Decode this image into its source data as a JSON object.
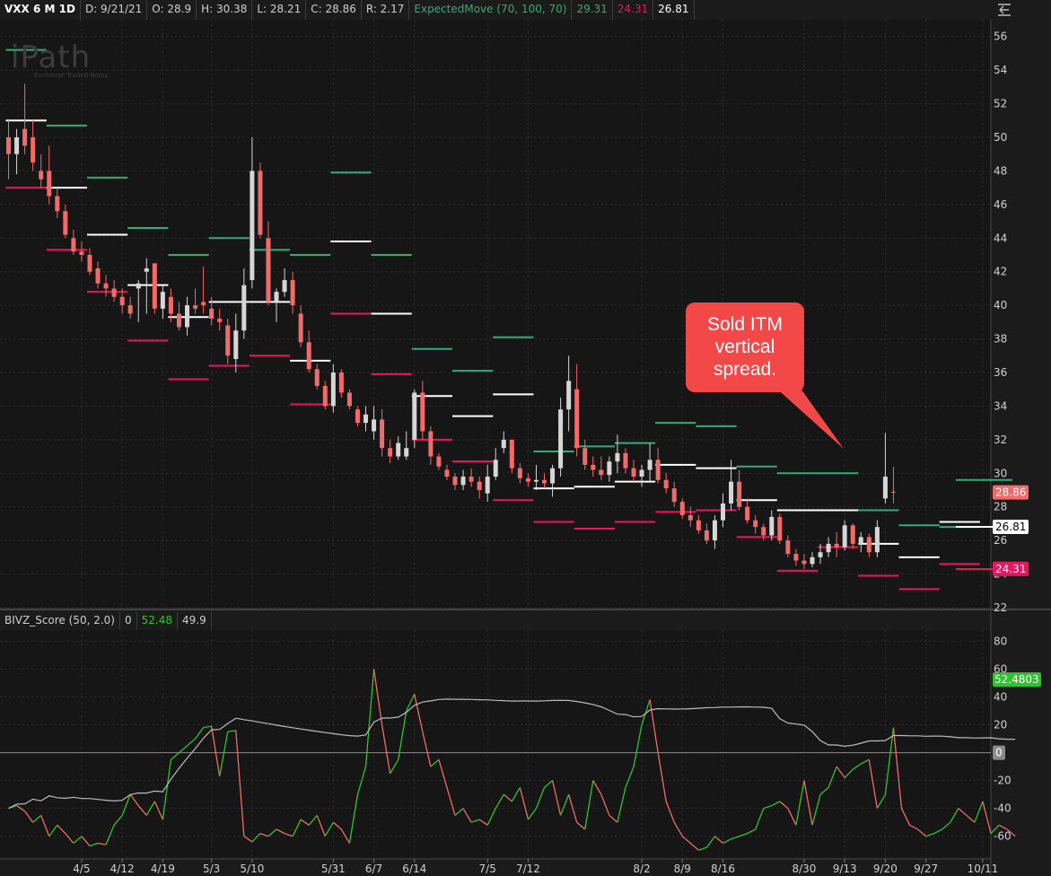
{
  "header": {
    "symbol": "VXX 6 M 1D",
    "date": "D: 9/21/21",
    "open": "O: 28.9",
    "high": "H: 30.38",
    "low": "L: 28.21",
    "close": "C: 28.86",
    "range": "R: 2.17",
    "study_name": "ExpectedMove (70, 100, 70)",
    "upper_value": "29.31",
    "lower_value": "24.31",
    "mid_value": "26.81"
  },
  "lower_header": {
    "study_name": "BIVZ_Score (50, 2.0)",
    "v0": "0",
    "v1": "52.48",
    "v2": "49.9"
  },
  "logo": {
    "name": "iPath",
    "sub": "Exchange Traded Notes"
  },
  "callout": {
    "text": "Sold ITM vertical spread."
  },
  "colors": {
    "up": "#d6d6d6",
    "down": "#f26a6a",
    "em_upper": "#2fae78",
    "em_lower": "#e8175d",
    "em_mid": "#ffffff",
    "osc_up": "#2ec42e",
    "osc_down": "#f26a6a",
    "avg": "#bcbcbc",
    "grid": "#2c2c2c",
    "axis_text": "#d0d0d0"
  },
  "chart_data": [
    {
      "type": "candlestick",
      "title": "VXX 6 M 1D",
      "ylim": [
        22,
        57
      ],
      "y_ticks": [
        22,
        24,
        26,
        28,
        30,
        32,
        34,
        36,
        38,
        40,
        42,
        44,
        46,
        48,
        50,
        52,
        54,
        56
      ],
      "x_tick_labels": [
        "4/5",
        "4/12",
        "4/19",
        "5/3",
        "5/10",
        "5/31",
        "6/7",
        "6/14",
        "7/5",
        "7/12",
        "8/2",
        "8/9",
        "8/16",
        "8/30",
        "9/13",
        "9/20",
        "9/27",
        "10/11"
      ],
      "x_tick_index": [
        9,
        14,
        19,
        25,
        30,
        40,
        45,
        50,
        59,
        64,
        78,
        83,
        88,
        98,
        103,
        108,
        113,
        120
      ],
      "x_range": [
        -0.5,
        121
      ],
      "price_labels": {
        "last": "28.86",
        "em_mid": "26.81",
        "em_lower": "24.31"
      },
      "candles": [
        [
          50,
          51,
          47.5,
          49
        ],
        [
          49,
          50.5,
          47.8,
          50
        ],
        [
          50.5,
          53.2,
          49,
          49.5
        ],
        [
          50,
          51,
          48,
          48.5
        ],
        [
          48,
          49,
          47,
          47.5
        ],
        [
          48,
          49.5,
          46,
          46.5
        ],
        [
          46.5,
          47,
          45.2,
          45.6
        ],
        [
          45.6,
          46,
          44,
          44.2
        ],
        [
          44,
          44.5,
          43,
          43.2
        ],
        [
          43.2,
          43.8,
          42.6,
          43
        ],
        [
          43,
          43.4,
          41.8,
          42
        ],
        [
          42.2,
          42.6,
          41,
          41.3
        ],
        [
          41.3,
          41.8,
          40.5,
          41
        ],
        [
          41,
          41.5,
          40.2,
          40.5
        ],
        [
          40.5,
          41,
          39.5,
          40
        ],
        [
          40,
          40.5,
          39.2,
          39.5
        ],
        [
          41,
          41.5,
          39,
          41.3
        ],
        [
          42,
          42.8,
          39.5,
          42.2
        ],
        [
          42.5,
          42.5,
          39.5,
          39.8
        ],
        [
          39.8,
          41.2,
          39.2,
          40.8
        ],
        [
          40.5,
          41,
          39,
          39.5
        ],
        [
          39.5,
          40.2,
          38.5,
          38.7
        ],
        [
          38.7,
          40.5,
          38.2,
          40
        ],
        [
          40,
          41,
          39.5,
          39.8
        ],
        [
          40.2,
          42.3,
          39.5,
          40
        ],
        [
          39.8,
          40.5,
          38.8,
          39.2
        ],
        [
          39.2,
          39.8,
          38.5,
          39
        ],
        [
          38.8,
          39.2,
          36.5,
          37
        ],
        [
          36.8,
          39.5,
          36,
          38.5
        ],
        [
          38.5,
          42.2,
          38,
          41.2
        ],
        [
          41.5,
          50,
          41,
          48
        ],
        [
          48,
          48.5,
          44,
          44.2
        ],
        [
          44,
          45,
          40,
          40.2
        ],
        [
          40.2,
          41,
          39,
          40.8
        ],
        [
          40.8,
          42.2,
          40.5,
          41.5
        ],
        [
          41.5,
          42,
          39.5,
          40
        ],
        [
          39.5,
          40,
          37.5,
          37.8
        ],
        [
          37.8,
          38.5,
          36,
          36.2
        ],
        [
          36.2,
          36.5,
          35,
          35.2
        ],
        [
          35.2,
          35.5,
          33.8,
          34
        ],
        [
          34,
          36.5,
          33.6,
          36
        ],
        [
          36,
          36.2,
          34.5,
          34.8
        ],
        [
          34.8,
          35,
          33.8,
          34
        ],
        [
          33.8,
          34,
          32.8,
          33
        ],
        [
          33,
          34,
          32.5,
          33.5
        ],
        [
          32.5,
          34,
          32,
          33.2
        ],
        [
          33.2,
          33.8,
          31,
          31.5
        ],
        [
          31.5,
          32,
          30.6,
          31
        ],
        [
          31,
          32.2,
          30.8,
          31.8
        ],
        [
          31,
          32.5,
          30.8,
          31.5
        ],
        [
          32,
          35,
          31.5,
          34.8
        ],
        [
          34.8,
          35.5,
          32,
          32.5
        ],
        [
          32.5,
          32.8,
          30.5,
          31
        ],
        [
          31,
          31.2,
          30.2,
          30.4
        ],
        [
          30.2,
          30.5,
          29.6,
          29.8
        ],
        [
          29.8,
          30,
          29,
          29.3
        ],
        [
          29.3,
          30.2,
          29,
          29.8
        ],
        [
          29.8,
          30.3,
          29.2,
          29.5
        ],
        [
          29.5,
          29.8,
          28.5,
          29
        ],
        [
          28.8,
          30.5,
          28.3,
          29.8
        ],
        [
          29.8,
          31.5,
          29.6,
          30.8
        ],
        [
          31.5,
          32.5,
          31.2,
          32
        ],
        [
          32,
          32,
          30,
          30.3
        ],
        [
          30.3,
          30.6,
          29.4,
          29.7
        ],
        [
          29.7,
          30,
          29.2,
          29.5
        ],
        [
          29.5,
          30.5,
          29,
          29.6
        ],
        [
          29.6,
          30,
          29.1,
          29.4
        ],
        [
          29.4,
          30.5,
          28.6,
          30.3
        ],
        [
          30.3,
          34.5,
          29.8,
          33.8
        ],
        [
          33.8,
          37,
          32.5,
          35.5
        ],
        [
          35,
          36.5,
          31,
          31.5
        ],
        [
          31.5,
          32,
          30.2,
          30.5
        ],
        [
          30.5,
          31,
          29.8,
          30.2
        ],
        [
          30.2,
          31,
          29.6,
          29.9
        ],
        [
          29.9,
          31,
          29.5,
          30.7
        ],
        [
          30.7,
          32.3,
          30,
          31.2
        ],
        [
          31.2,
          31.5,
          30,
          30.3
        ],
        [
          30.3,
          30.8,
          29.5,
          29.8
        ],
        [
          29.8,
          30.5,
          29.2,
          30.2
        ],
        [
          30.2,
          31.8,
          29.5,
          30.8
        ],
        [
          30.8,
          31.5,
          29.4,
          29.6
        ],
        [
          29.6,
          30,
          28.8,
          29.1
        ],
        [
          29.1,
          29.5,
          28,
          28.3
        ],
        [
          28.3,
          28.5,
          27.3,
          27.5
        ],
        [
          27.5,
          28,
          26.8,
          27.2
        ],
        [
          27.2,
          27.5,
          26.4,
          26.6
        ],
        [
          26.6,
          27,
          25.8,
          26
        ],
        [
          26,
          27.5,
          25.5,
          27.2
        ],
        [
          27.2,
          28.8,
          26.8,
          28.2
        ],
        [
          28.2,
          30.8,
          27.8,
          29.5
        ],
        [
          29.5,
          30.2,
          27.8,
          28
        ],
        [
          28,
          28.5,
          27,
          27.2
        ],
        [
          27.2,
          27.5,
          26.4,
          26.8
        ],
        [
          26.8,
          27,
          26,
          26.3
        ],
        [
          26.3,
          27.8,
          26,
          27.4
        ],
        [
          27.4,
          27.6,
          25.8,
          26
        ],
        [
          26,
          26.3,
          25,
          25.2
        ],
        [
          25.2,
          25.5,
          24.5,
          24.8
        ],
        [
          24.8,
          25.2,
          24.3,
          24.6
        ],
        [
          24.6,
          25.3,
          24.4,
          25
        ],
        [
          25,
          25.8,
          24.6,
          25.3
        ],
        [
          25.3,
          26.2,
          25,
          25.8
        ],
        [
          25.8,
          26.5,
          25,
          25.6
        ],
        [
          25.6,
          27.2,
          25.4,
          26.9
        ],
        [
          26.9,
          27,
          25.5,
          25.8
        ],
        [
          25.8,
          26.5,
          25.3,
          26.2
        ],
        [
          26.2,
          26.4,
          25,
          25.3
        ],
        [
          25.3,
          27.2,
          25,
          26.8
        ],
        [
          28.5,
          32.4,
          28.2,
          29.8
        ],
        [
          28.9,
          30.38,
          28.21,
          28.86
        ]
      ],
      "expected_move": [
        {
          "i0": 0,
          "i1": 5,
          "hi": 55.2,
          "mid": 51,
          "lo": 47
        },
        {
          "i0": 5,
          "i1": 10,
          "hi": 50.7,
          "mid": 47,
          "lo": 43.3
        },
        {
          "i0": 10,
          "i1": 15,
          "hi": 47.6,
          "mid": 44.2,
          "lo": 40.8
        },
        {
          "i0": 15,
          "i1": 20,
          "hi": 44.6,
          "mid": 41.2,
          "lo": 37.9
        },
        {
          "i0": 20,
          "i1": 25,
          "hi": 43,
          "mid": 39.3,
          "lo": 35.6
        },
        {
          "i0": 25,
          "i1": 30,
          "hi": 44,
          "mid": 40.2,
          "lo": 36.4
        },
        {
          "i0": 30,
          "i1": 35,
          "hi": 43.3,
          "mid": 40.2,
          "lo": 37
        },
        {
          "i0": 35,
          "i1": 40,
          "hi": 43,
          "mid": 36.7,
          "lo": 34.1
        },
        {
          "i0": 40,
          "i1": 45,
          "hi": 47.9,
          "mid": 43.8,
          "lo": 39.5
        },
        {
          "i0": 45,
          "i1": 50,
          "hi": 43,
          "mid": 39.5,
          "lo": 35.9
        },
        {
          "i0": 50,
          "i1": 55,
          "hi": 37.4,
          "mid": 34.6,
          "lo": 32
        },
        {
          "i0": 55,
          "i1": 60,
          "hi": 36.1,
          "mid": 33.4,
          "lo": 30.7
        },
        {
          "i0": 60,
          "i1": 65,
          "hi": 38.1,
          "mid": 34.7,
          "lo": 28.4
        },
        {
          "i0": 65,
          "i1": 70,
          "hi": 31.3,
          "mid": 29.1,
          "lo": 27.1
        },
        {
          "i0": 70,
          "i1": 75,
          "hi": 31.6,
          "mid": 29.2,
          "lo": 26.7
        },
        {
          "i0": 75,
          "i1": 80,
          "hi": 31.8,
          "mid": 29.5,
          "lo": 27.1
        },
        {
          "i0": 80,
          "i1": 85,
          "hi": 33,
          "mid": 30.5,
          "lo": 27.7
        },
        {
          "i0": 85,
          "i1": 90,
          "hi": 32.8,
          "mid": 30.3,
          "lo": 27.8
        },
        {
          "i0": 90,
          "i1": 95,
          "hi": 30.4,
          "mid": 28.4,
          "lo": 26.2
        },
        {
          "i0": 95,
          "i1": 100,
          "hi": 30,
          "mid": 27.8,
          "lo": 24.2
        },
        {
          "i0": 100,
          "i1": 105,
          "hi": 30,
          "mid": 27.8,
          "lo": 25.6
        },
        {
          "i0": 105,
          "i1": 110,
          "hi": 27.8,
          "mid": 25.8,
          "lo": 23.9
        },
        {
          "i0": 110,
          "i1": 115,
          "hi": 26.9,
          "mid": 25,
          "lo": 23.1
        },
        {
          "i0": 115,
          "i1": 120,
          "hi": 26.8,
          "mid": 27.1,
          "lo": 24.6
        },
        {
          "i0": 117,
          "i1": 124,
          "hi": 29.6,
          "mid": 26.81,
          "lo": 24.3
        }
      ]
    },
    {
      "type": "line",
      "title": "BIVZ_Score (50, 2.0)",
      "ylim": [
        -75,
        88
      ],
      "y_ticks": [
        -60,
        -40,
        -20,
        0,
        20,
        40,
        60,
        80
      ],
      "zero_label": "0",
      "last_label": "52.4803",
      "series": [
        {
          "values": [
            -40,
            -38,
            -42,
            -50,
            -45,
            -60,
            -52,
            -58,
            -65,
            -60,
            -67,
            -65,
            -66,
            -52,
            -45,
            -30,
            -38,
            -45,
            -35,
            -48,
            -5,
            0,
            5,
            10,
            18,
            19,
            -17,
            15,
            16,
            -60,
            -64,
            -58,
            -60,
            -55,
            -58,
            -60,
            -48,
            -52,
            -45,
            -60,
            -50,
            -55,
            -65,
            -30,
            -10,
            60,
            20,
            -15,
            -5,
            30,
            42,
            15,
            -10,
            -5,
            -25,
            -45,
            -40,
            -50,
            -48,
            -52,
            -40,
            -30,
            -35,
            -25,
            -48,
            -40,
            -25,
            -20,
            -45,
            -30,
            -50,
            -55,
            -20,
            -30,
            -45,
            -50,
            -25,
            -10,
            20,
            38,
            0,
            -35,
            -50,
            -60,
            -65,
            -70,
            -68,
            -60,
            -65,
            -62,
            -60,
            -58,
            -55,
            -40,
            -38,
            -35,
            -40,
            -52,
            -20,
            -52,
            -30,
            -25,
            -10,
            -18,
            -12,
            -8,
            -5,
            -40,
            -30,
            18,
            -40,
            -52,
            -55,
            -60,
            -58,
            -55,
            -50,
            -40,
            -45,
            -50,
            -35,
            -58,
            -52,
            -55,
            -60
          ]
        }
      ]
    }
  ]
}
